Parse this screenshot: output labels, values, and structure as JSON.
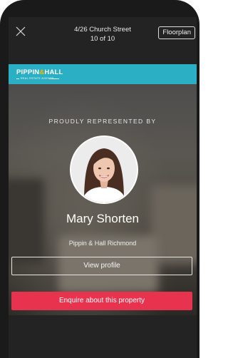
{
  "header": {
    "address": "4/26 Church Street",
    "counter": "10 of 10",
    "floorplan_label": "Floorplan"
  },
  "brand": {
    "logo_part1": "PIPPIN",
    "logo_amp": "&",
    "logo_part2": "HALL",
    "logo_tagline": "REAL ESTATE AGENTS",
    "bar_color": "#2bafc4"
  },
  "agent": {
    "represented_label": "PROUDLY REPRESENTED BY",
    "name": "Mary Shorten",
    "agency": "Pippin & Hall Richmond",
    "view_profile_label": "View profile"
  },
  "cta": {
    "enquire_label": "Enquire about this property",
    "color": "#e8334f"
  },
  "icons": {
    "close": "close-icon"
  }
}
